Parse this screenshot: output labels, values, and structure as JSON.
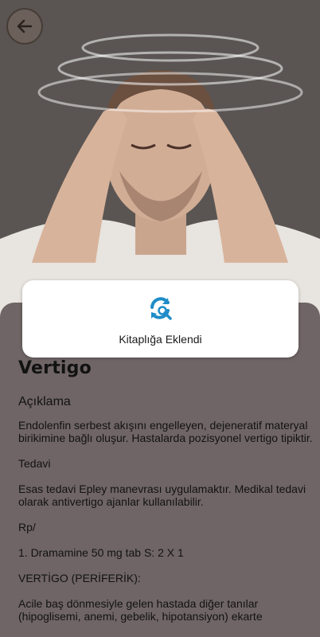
{
  "header": {
    "back_icon": "arrow-left-icon",
    "image": "man-with-headache-photo"
  },
  "toast": {
    "icon": "refresh-search-icon",
    "message": "Kitaplığa Eklendi",
    "accent_color": "#1e8cc8"
  },
  "article": {
    "title": "Vertigo",
    "section": "Açıklama",
    "paragraphs": [
      "Endolenfin serbest akışını engelleyen, dejeneratif materyal birikimine bağlı oluşur. Hastalarda pozisyonel vertigo tipiktir.",
      "Tedavi",
      "Esas tedavi Epley manevrası uygulamaktır. Medikal tedavi olarak antivertigo ajanlar kullanılabilir.",
      "Rp/",
      "1. Dramamine 50 mg tab S: 2 X 1",
      "VERTİGO (PERİFERİK):",
      "Acile baş dönmesiyle gelen hastada diğer tanılar (hipoglisemi, anemi, gebelik, hipotansiyon) ekarte"
    ]
  }
}
